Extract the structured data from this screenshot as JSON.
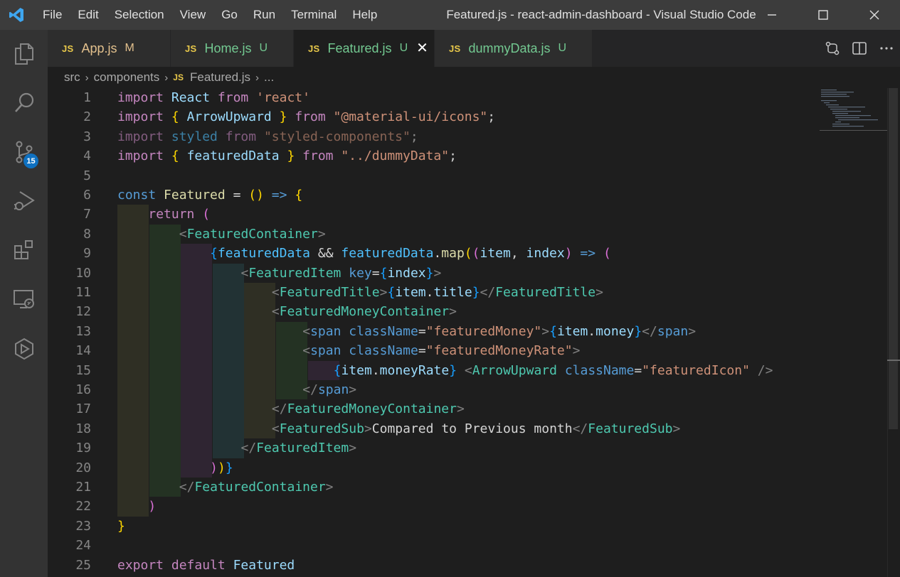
{
  "window": {
    "title": "Featured.js - react-admin-dashboard - Visual Studio Code",
    "menu": [
      "File",
      "Edit",
      "Selection",
      "View",
      "Go",
      "Run",
      "Terminal",
      "Help"
    ]
  },
  "activity_bar": {
    "items": [
      "explorer-icon",
      "search-icon",
      "source-control-icon",
      "run-debug-icon",
      "extensions-icon",
      "remote-explorer-icon",
      "live-share-icon"
    ],
    "source_control_badge": "15"
  },
  "tabs": [
    {
      "icon": "JS",
      "name": "App.js",
      "status": "M",
      "active": false
    },
    {
      "icon": "JS",
      "name": "Home.js",
      "status": "U",
      "active": false
    },
    {
      "icon": "JS",
      "name": "Featured.js",
      "status": "U",
      "active": true
    },
    {
      "icon": "JS",
      "name": "dummyData.js",
      "status": "U",
      "active": false
    }
  ],
  "breadcrumb": {
    "parts": [
      "src",
      "components",
      "Featured.js",
      "..."
    ],
    "file_icon": "JS"
  },
  "editor": {
    "line_numbers": [
      "1",
      "2",
      "3",
      "4",
      "5",
      "6",
      "7",
      "8",
      "9",
      "10",
      "11",
      "12",
      "13",
      "14",
      "15",
      "16",
      "17",
      "18",
      "19",
      "20",
      "21",
      "22",
      "23",
      "24",
      "25"
    ],
    "lines": [
      "import React from 'react'",
      "import { ArrowUpward } from \"@material-ui/icons\";",
      "import styled from \"styled-components\";",
      "import { featuredData } from \"../dummyData\";",
      "",
      "const Featured = () => {",
      "    return (",
      "        <FeaturedContainer>",
      "            {featuredData && featuredData.map((item, index) => (",
      "                <FeaturedItem key={index}>",
      "                    <FeaturedTitle>{item.title}</FeaturedTitle>",
      "                    <FeaturedMoneyContainer>",
      "                        <span className=\"featuredMoney\">{item.money}</span>",
      "                        <span className=\"featuredMoneyRate\">",
      "                            {item.moneyRate} <ArrowUpward className=\"featuredIcon\" />",
      "                        </span>",
      "                    </FeaturedMoneyContainer>",
      "                    <FeaturedSub>Compared to Previous month</FeaturedSub>",
      "                </FeaturedItem>",
      "            ))}",
      "        </FeaturedContainer>",
      "    )",
      "}",
      "",
      "export default Featured"
    ]
  },
  "colors": {
    "accent": "#0e70c0",
    "keyword": "#c586c0",
    "string": "#ce9178",
    "component": "#4ec9b0",
    "variable": "#9cdcfe",
    "bracket_gold": "#ffd700"
  }
}
